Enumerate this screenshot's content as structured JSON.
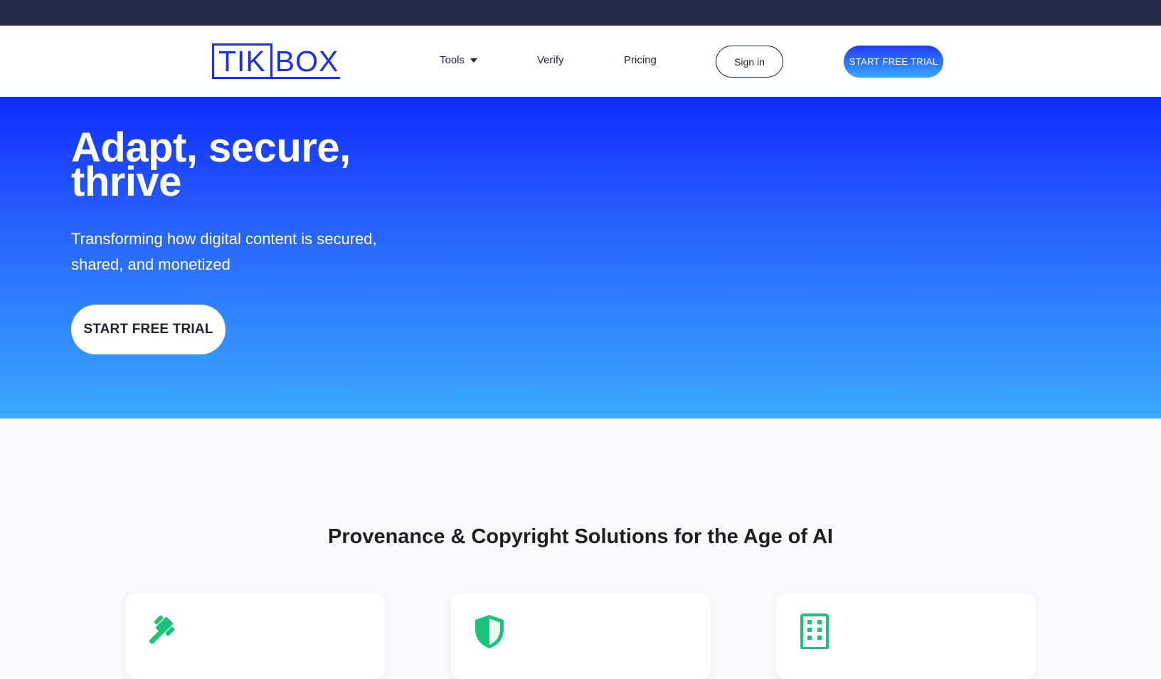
{
  "brand": {
    "logo_left": "TIK",
    "logo_right": "BOX",
    "accent": "#1b2ee8",
    "topbar_color": "#252c4a"
  },
  "nav": {
    "tools": "Tools",
    "verify": "Verify",
    "pricing": "Pricing",
    "signin": "Sign in",
    "cta": "START FREE TRIAL"
  },
  "hero": {
    "title": "Adapt, secure, thrive",
    "subtitle": "Transforming how digital content is secured, shared, and monetized",
    "cta": "START FREE TRIAL",
    "gradient": [
      "#112cfe",
      "#3aaaff"
    ]
  },
  "section": {
    "title": "Provenance & Copyright Solutions for the Age of AI",
    "cards": [
      {
        "icon": "gavel-icon",
        "color": "#16c47a"
      },
      {
        "icon": "shield-icon",
        "color": "#16c47a"
      },
      {
        "icon": "building-icon",
        "color": "#16c47a"
      }
    ]
  }
}
